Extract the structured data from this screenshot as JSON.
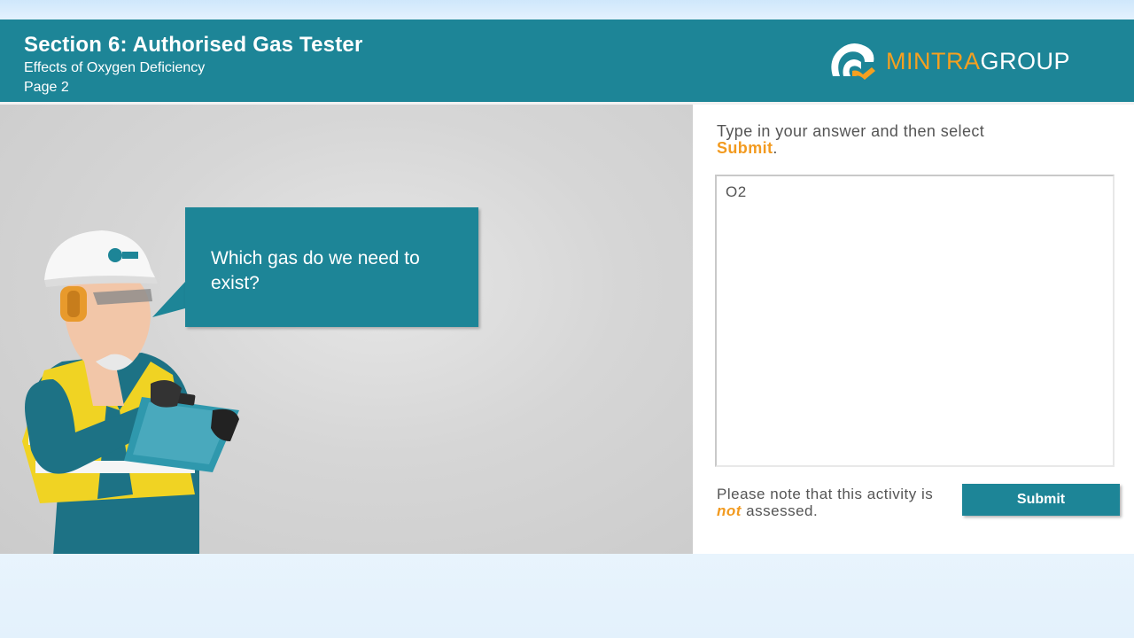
{
  "header": {
    "title": "Section 6: Authorised Gas Tester",
    "subtitle": "Effects of Oxygen Deficiency",
    "page": "Page 2"
  },
  "logo": {
    "name_part1": "MINTRA",
    "name_part2": "GROUP",
    "icon": "mintra-logo-icon"
  },
  "scene": {
    "question": "Which gas do we need to exist?",
    "character": "gas-tester-worker"
  },
  "panel": {
    "instruction_prefix": "Type in your answer and then select",
    "instruction_keyword": "Submit",
    "instruction_suffix": ".",
    "answer_value": "O2",
    "note_prefix": "Please note that this activity is",
    "note_emphasis": "not",
    "note_suffix": "assessed.",
    "submit_label": "Submit"
  },
  "colors": {
    "teal": "#1d8597",
    "accent_orange": "#f29a1f",
    "text_gray": "#555555"
  }
}
